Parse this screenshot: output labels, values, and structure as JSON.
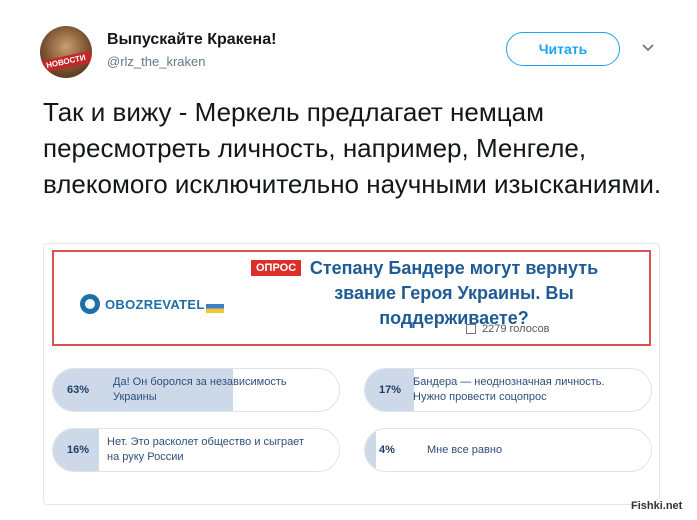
{
  "account": {
    "name": "Выпускайте Кракена!",
    "handle": "@rlz_the_kraken",
    "avatar_badge": "НОВОСТИ"
  },
  "follow_label": "Читать",
  "tweet_text": "Так и вижу - Меркель предлагает немцам пересмотреть личность, например, Менгеле, влекомого исключительно научными изысканиями.",
  "card": {
    "logo_text": "OBOZREVATEL",
    "tag": "ОПРОС",
    "headline": "Степану Бандере могут вернуть звание Героя Украины. Вы поддерживаете?",
    "votes": "2279 голосов",
    "options": [
      {
        "percent": "63%",
        "fraction": 0.63,
        "label": "Да! Он боролся за независимость Украины"
      },
      {
        "percent": "17%",
        "fraction": 0.17,
        "label": "Бандера — неоднозначная личность. Нужно провести соцопрос"
      },
      {
        "percent": "16%",
        "fraction": 0.16,
        "label": "Нет. Это расколет общество и сыграет на руку России"
      },
      {
        "percent": "4%",
        "fraction": 0.04,
        "label": "Мне все равно"
      }
    ]
  },
  "watermark": "Fishki.net",
  "colors": {
    "twitter_blue": "#1da1f2",
    "poll_red": "#d9302c",
    "headline_blue": "#1f5b95",
    "bar_fill": "#cdd9e8"
  }
}
